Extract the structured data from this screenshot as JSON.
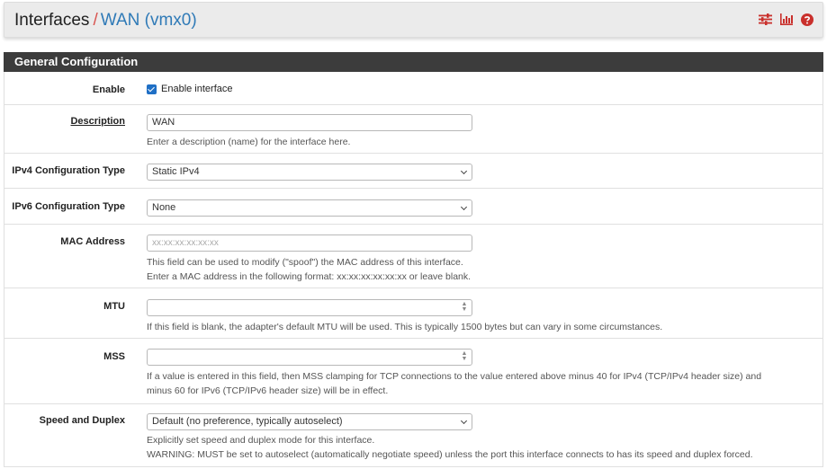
{
  "breadcrumb": {
    "parent": "Interfaces",
    "separator": "/",
    "current": "WAN (vmx0)"
  },
  "header_icons": [
    "sliders-icon",
    "bar-chart-icon",
    "help-icon"
  ],
  "colors": {
    "accent_red": "#d9534f",
    "link_blue": "#2f7ab7",
    "panel_heading": "#3c3c3c",
    "checkbox": "#1f6fc5",
    "icon_red": "#c9302c"
  },
  "panel": {
    "title": "General Configuration"
  },
  "fields": {
    "enable": {
      "label": "Enable",
      "checkbox_label": "Enable interface",
      "checked": true
    },
    "description": {
      "label": "Description",
      "value": "WAN",
      "help": "Enter a description (name) for the interface here."
    },
    "ipv4_type": {
      "label": "IPv4 Configuration Type",
      "value": "Static IPv4"
    },
    "ipv6_type": {
      "label": "IPv6 Configuration Type",
      "value": "None"
    },
    "mac": {
      "label": "MAC Address",
      "placeholder": "xx:xx:xx:xx:xx:xx",
      "help1": "This field can be used to modify (\"spoof\") the MAC address of this interface.",
      "help2": "Enter a MAC address in the following format: xx:xx:xx:xx:xx:xx or leave blank."
    },
    "mtu": {
      "label": "MTU",
      "value": "",
      "help": "If this field is blank, the adapter's default MTU will be used. This is typically 1500 bytes but can vary in some circumstances."
    },
    "mss": {
      "label": "MSS",
      "value": "",
      "help1": "If a value is entered in this field, then MSS clamping for TCP connections to the value entered above minus 40 for IPv4 (TCP/IPv4 header size) and",
      "help2": "minus 60 for IPv6 (TCP/IPv6 header size) will be in effect."
    },
    "speed": {
      "label": "Speed and Duplex",
      "value": "Default (no preference, typically autoselect)",
      "help1": "Explicitly set speed and duplex mode for this interface.",
      "help2": "WARNING: MUST be set to autoselect (automatically negotiate speed) unless the port this interface connects to has its speed and duplex forced."
    }
  }
}
